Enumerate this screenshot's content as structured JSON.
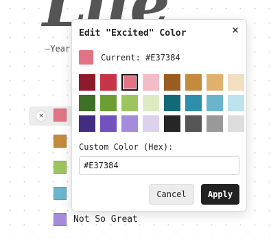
{
  "background": {
    "logo_text": "Life",
    "subtitle": "—Year"
  },
  "legend": {
    "remove_symbol": "×",
    "items": [
      {
        "color": "#E37384",
        "label": "",
        "active": true
      },
      {
        "color": "#C48A3E",
        "label": ""
      },
      {
        "color": "#9DC55F",
        "label": ""
      },
      {
        "color": "#6AB4CC",
        "label": ""
      },
      {
        "color": "#A58BDB",
        "label": "Not So Great"
      }
    ]
  },
  "dialog": {
    "title": "Edit \"Excited\" Color",
    "close_icon": "×",
    "current_label": "Current: #E37384",
    "current_color": "#E37384",
    "palette": [
      "#8E1B2B",
      "#C63547",
      "#E37384",
      "#F3BCC7",
      "#9A5C21",
      "#C48A3E",
      "#DFB16E",
      "#F1DFC0",
      "#3E7028",
      "#6D9E33",
      "#9DC55F",
      "#DCEBC2",
      "#126978",
      "#2E8FAB",
      "#6AB4CC",
      "#BDE3EC",
      "#432C84",
      "#7352BE",
      "#A58BDB",
      "#DCD2EE",
      "#262626",
      "#555555",
      "#999999",
      "#DDDDDD"
    ],
    "selected_index": 2,
    "custom_label": "Custom Color (Hex):",
    "hex_value": "#E37384",
    "cancel_label": "Cancel",
    "apply_label": "Apply"
  }
}
